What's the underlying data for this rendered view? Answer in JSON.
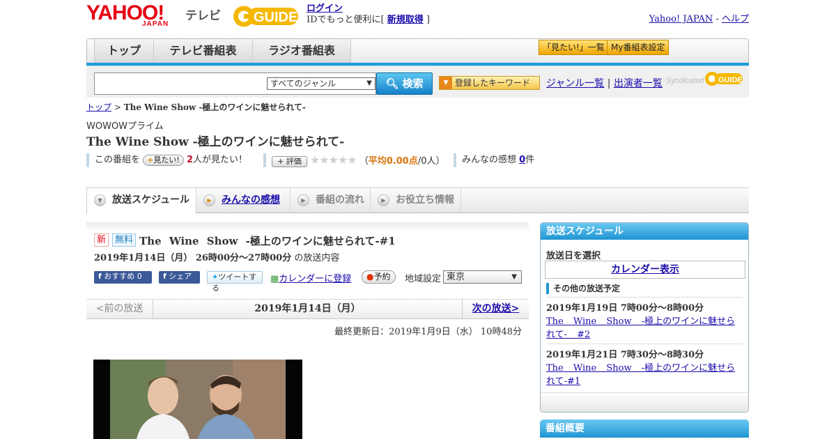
{
  "header": {
    "yahoo_logo": "YAHOO!",
    "japan_logo": "JAPAN",
    "tv_label": "テレビ",
    "guide_logo": "GUIDE",
    "login_link": "ログイン",
    "login_prompt_before": "IDでもっと便利に[",
    "signup_link": "新規取得",
    "login_prompt_after": "]",
    "yahoo_japan_link": "Yahoo! JAPAN",
    "separator": " - ",
    "help_link": "ヘルプ"
  },
  "nav": {
    "tabs": [
      "トップ",
      "テレビ番組表",
      "ラジオ番組表"
    ],
    "want_list_button": "「見たい!」一覧",
    "my_schedule_button": "My番組表設定"
  },
  "search": {
    "genre_value": "すべてのジャンル",
    "search_button": "検索",
    "keyword_button": "登録したキーワード",
    "genre_list_link": "ジャンル一覧",
    "divider": "|",
    "cast_list_link": "出演者一覧",
    "syndicated": "Syndicated"
  },
  "breadcrumb": {
    "home": "トップ",
    "sep": " > ",
    "current": "The Wine Show -極上のワインに魅せられて-"
  },
  "program": {
    "channel": "WOWOWプライム",
    "title": "The Wine Show -極上のワインに魅せられて-",
    "want_prefix": "この番組を",
    "want_button": "見たい!",
    "want_count": "2",
    "want_suffix": "人が見たい！",
    "rate_button": "評価",
    "stars": "★★★★★",
    "avg_open": "（",
    "avg_label": "平均0.00点",
    "avg_rest": "/0人）",
    "impressions_label": "みんなの感想",
    "impressions_count": "0",
    "impressions_unit": "件"
  },
  "tabs": [
    {
      "label": "放送スケジュール"
    },
    {
      "label": "みんなの感想"
    },
    {
      "label": "番組の流れ"
    },
    {
      "label": "お役立ち情報"
    }
  ],
  "episode": {
    "badge_new": "新",
    "badge_free": "無料",
    "title": "The Wine Show -極上のワインに魅せられて-#1",
    "datetime": "2019年1月14日（月） 26時00分～27時00分",
    "content_suffix": "の放送内容",
    "recommend": "おすすめ 0",
    "share": "シェア",
    "tweet": "ツイートする",
    "calendar_add": "カレンダーに登録",
    "reserve": "予約",
    "region_label": "地域設定",
    "region_value": "東京"
  },
  "pager": {
    "prev": "<前の放送",
    "current": "2019年1月14日（月）",
    "next": "次の放送>"
  },
  "last_updated": "最終更新日：2019年1月9日（水） 10時48分",
  "sidebar": {
    "schedule_title": "放送スケジュール",
    "select_date_label": "放送日を選択",
    "calendar_button": "カレンダー表示",
    "other_label": "その他の放送予定",
    "items": [
      {
        "date": "2019年1月19日 7時00分～8時00分",
        "link": "The Wine Show -極上のワインに魅せられて- #2"
      },
      {
        "date": "2019年1月21日 7時30分～8時30分",
        "link": "The Wine Show -極上のワインに魅せられて-#1"
      }
    ],
    "overview_title": "番組概要"
  },
  "colors": {
    "accent_blue": "#1e9fd8",
    "yahoo_red": "#e60012",
    "guide_yellow": "#f5b800",
    "link": "#1a0dab"
  }
}
